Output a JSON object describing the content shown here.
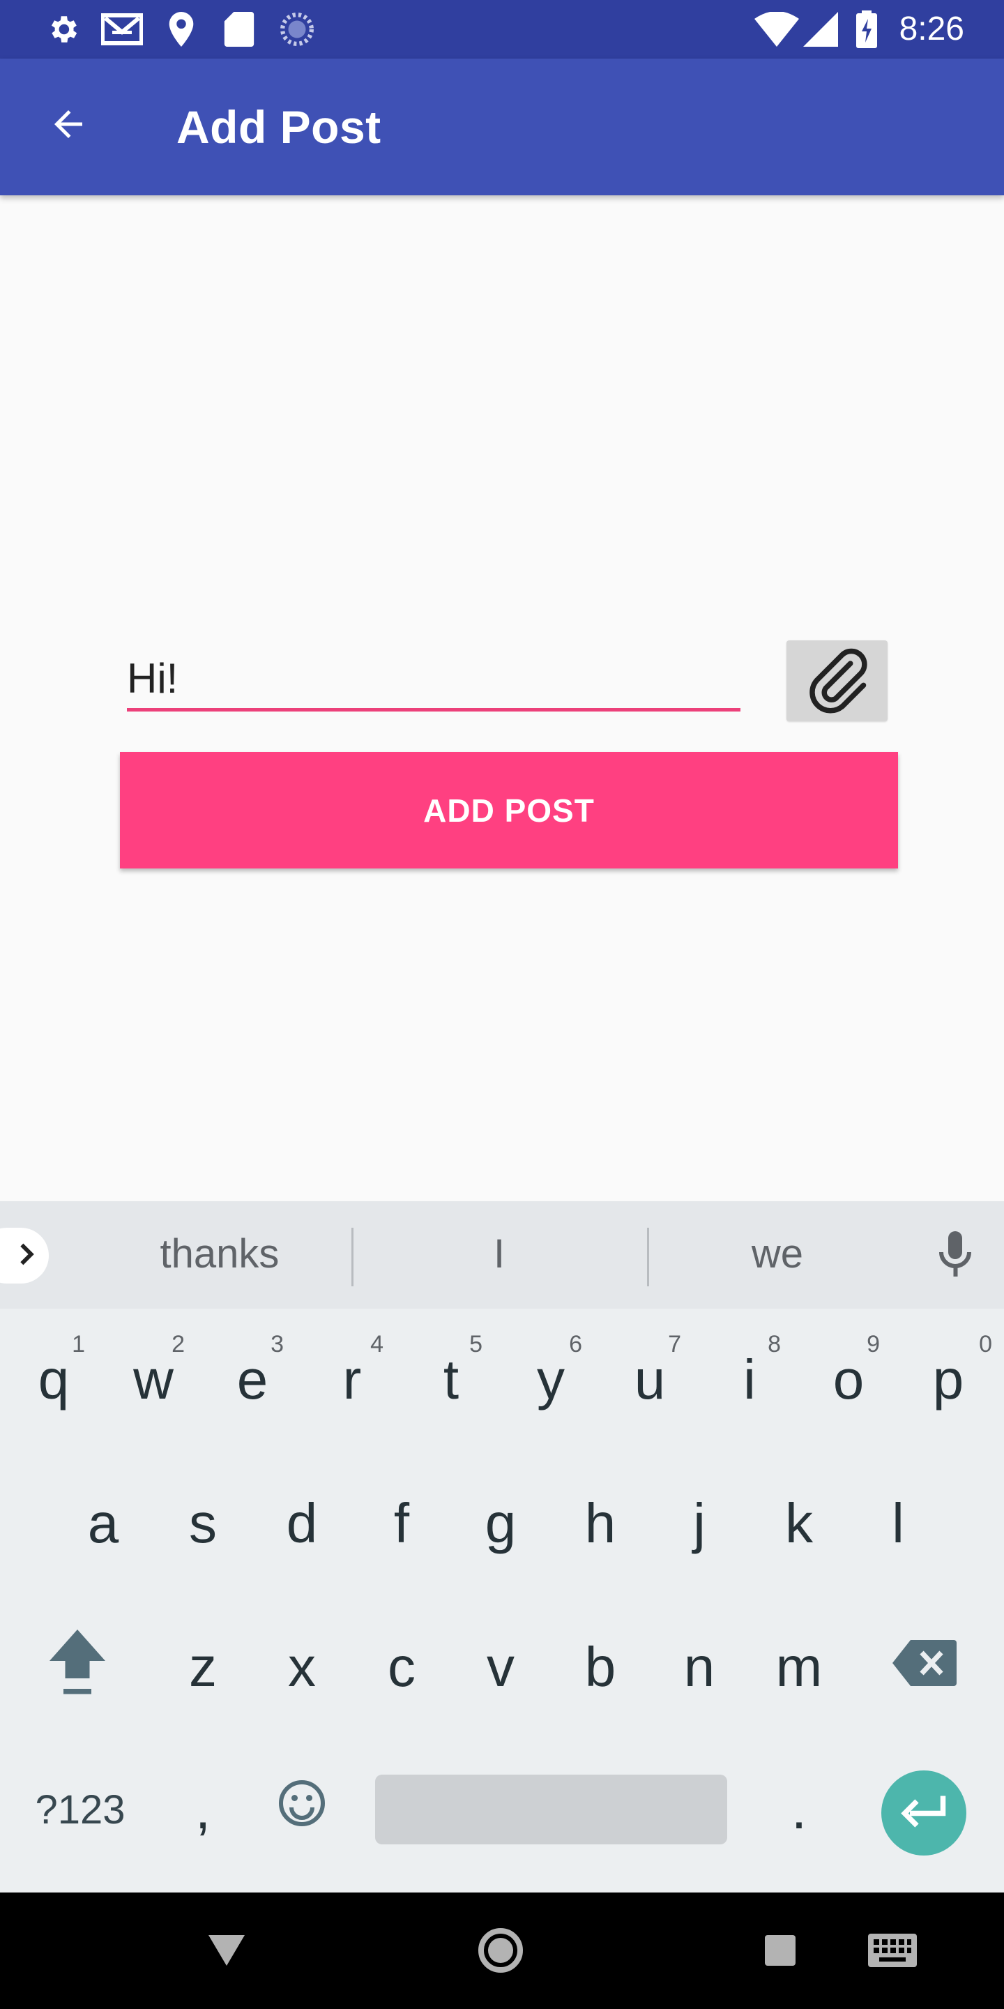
{
  "status_bar": {
    "time": "8:26",
    "left_icons": [
      "settings-icon",
      "gmail-icon",
      "location-icon",
      "sd-card-icon",
      "sync-icon"
    ],
    "right_icons": [
      "wifi-icon",
      "cellular-signal-icon",
      "battery-charging-icon"
    ]
  },
  "app_bar": {
    "title": "Add Post",
    "back_icon": "arrow-back-icon",
    "color": "#3f51b5",
    "status_color": "#303f9f"
  },
  "form": {
    "post_input_value": "Hi!",
    "attach_icon": "paperclip-icon",
    "add_post_label": "ADD POST",
    "accent_color": "#ff4081"
  },
  "keyboard": {
    "suggestions": [
      "thanks",
      "I",
      "we"
    ],
    "row1": [
      {
        "key": "q",
        "hint": "1"
      },
      {
        "key": "w",
        "hint": "2"
      },
      {
        "key": "e",
        "hint": "3"
      },
      {
        "key": "r",
        "hint": "4"
      },
      {
        "key": "t",
        "hint": "5"
      },
      {
        "key": "y",
        "hint": "6"
      },
      {
        "key": "u",
        "hint": "7"
      },
      {
        "key": "i",
        "hint": "8"
      },
      {
        "key": "o",
        "hint": "9"
      },
      {
        "key": "p",
        "hint": "0"
      }
    ],
    "row2": [
      "a",
      "s",
      "d",
      "f",
      "g",
      "h",
      "j",
      "k",
      "l"
    ],
    "row3": [
      "z",
      "x",
      "c",
      "v",
      "b",
      "n",
      "m"
    ],
    "symbols_label": "?123",
    "comma": ",",
    "period": ".",
    "enter_color": "#4db6ac"
  },
  "nav_bar": {
    "icons": [
      "back-triangle-icon",
      "home-circle-icon",
      "recents-square-icon",
      "keyboard-switch-icon"
    ]
  }
}
